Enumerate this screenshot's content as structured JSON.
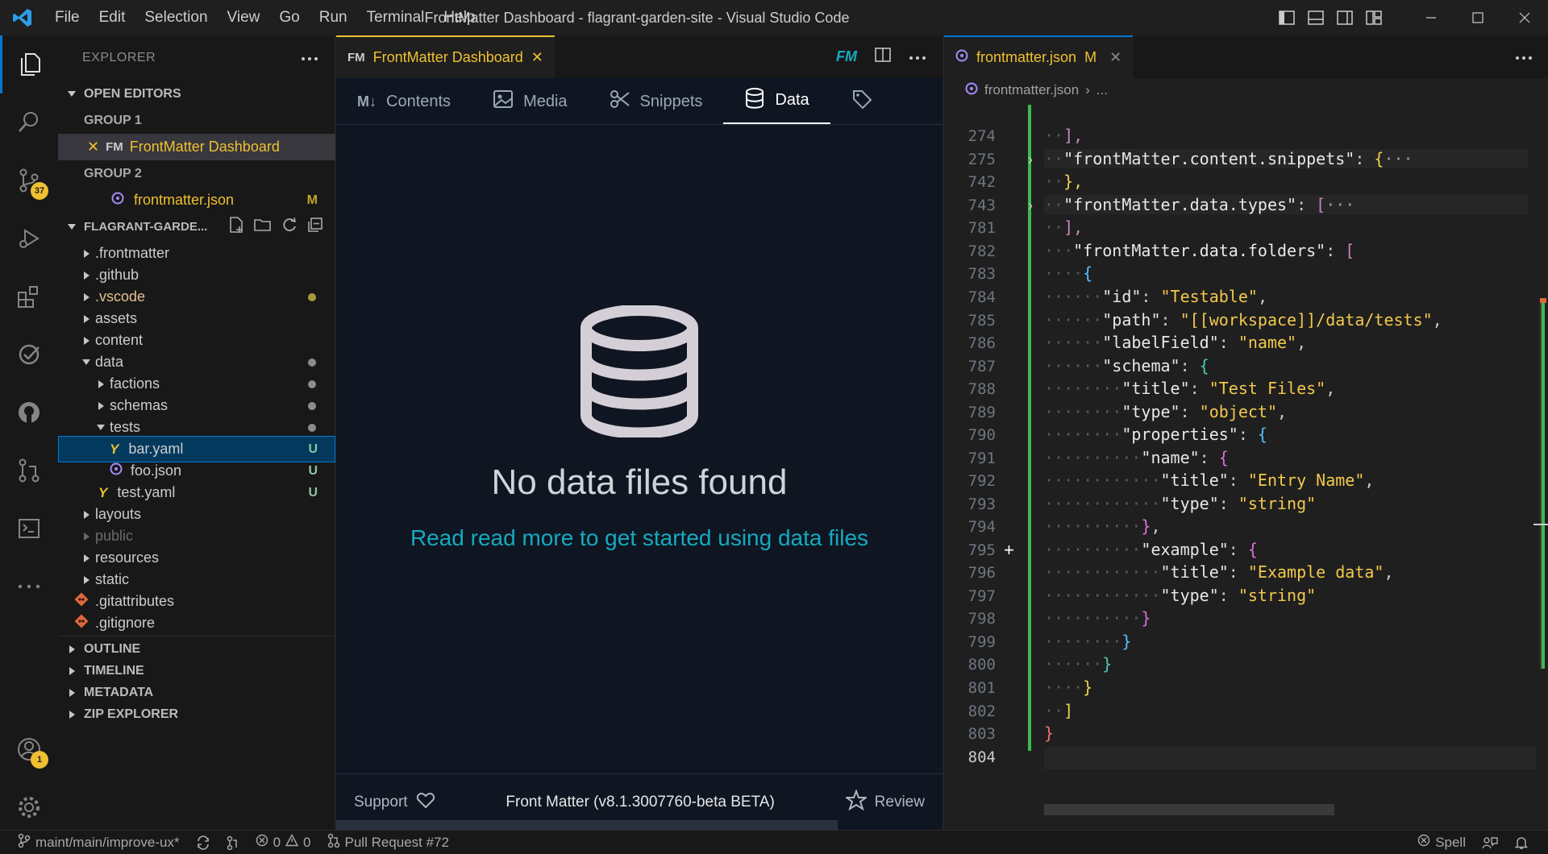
{
  "window": {
    "title": "FrontMatter Dashboard - flagrant-garden-site - Visual Studio Code"
  },
  "menu": [
    "File",
    "Edit",
    "Selection",
    "View",
    "Go",
    "Run",
    "Terminal",
    "Help"
  ],
  "activity": {
    "scm_badge": "37",
    "accounts_badge": "1"
  },
  "explorer": {
    "title": "EXPLORER",
    "open_editors": "OPEN EDITORS",
    "group1": "GROUP 1",
    "group1_file": "FrontMatter Dashboard",
    "group2": "GROUP 2",
    "group2_file": "frontmatter.json",
    "group2_deco": "M",
    "project": "FLAGRANT-GARDE...",
    "tree": [
      {
        "name": ".frontmatter"
      },
      {
        "name": ".github"
      },
      {
        "name": ".vscode"
      },
      {
        "name": "assets"
      },
      {
        "name": "content"
      },
      {
        "name": "data"
      },
      {
        "name": "factions"
      },
      {
        "name": "schemas"
      },
      {
        "name": "tests"
      },
      {
        "name": "bar.yaml",
        "deco": "U"
      },
      {
        "name": "foo.json",
        "deco": "U"
      },
      {
        "name": "test.yaml",
        "deco": "U"
      },
      {
        "name": "layouts"
      },
      {
        "name": "public"
      },
      {
        "name": "resources"
      },
      {
        "name": "static"
      },
      {
        "name": ".gitattributes"
      },
      {
        "name": ".gitignore"
      }
    ],
    "outline": "OUTLINE",
    "timeline": "TIMELINE",
    "metadata": "METADATA",
    "zip": "ZIP EXPLORER"
  },
  "left_editor": {
    "tab_label": "FrontMatter Dashboard",
    "nav": [
      "Contents",
      "Media",
      "Snippets",
      "Data"
    ],
    "empty_title": "No data files found",
    "empty_link": "Read read more to get started using data files",
    "footer_support": "Support",
    "footer_version": "Front Matter (v8.1.3007760-beta BETA)",
    "footer_review": "Review"
  },
  "right_editor": {
    "tab_label": "frontmatter.json",
    "tab_deco": "M",
    "breadcrumb_file": "frontmatter.json",
    "breadcrumb_more": "...",
    "line_numbers": [
      "274",
      "275",
      "742",
      "743",
      "781",
      "782",
      "783",
      "784",
      "785",
      "786",
      "787",
      "788",
      "789",
      "790",
      "791",
      "792",
      "793",
      "794",
      "795",
      "796",
      "797",
      "798",
      "799",
      "800",
      "801",
      "802",
      "803",
      "804"
    ],
    "code": {
      "l274": "],",
      "l275k": "\"frontMatter.content.snippets\"",
      "l742": "},",
      "l743k": "\"frontMatter.data.types\"",
      "l781": "],",
      "l782k": "\"frontMatter.data.folders\"",
      "k_id": "\"id\"",
      "v_id": "\"Testable\"",
      "k_path": "\"path\"",
      "v_path": "\"[[workspace]]/data/tests\"",
      "k_labelField": "\"labelField\"",
      "v_labelField": "\"name\"",
      "k_schema": "\"schema\"",
      "k_title": "\"title\"",
      "v_title": "\"Test Files\"",
      "k_type": "\"type\"",
      "v_type": "\"object\"",
      "k_properties": "\"properties\"",
      "k_name": "\"name\"",
      "v_name_title": "\"Entry Name\"",
      "v_string": "\"string\"",
      "k_example": "\"example\"",
      "v_example_title": "\"Example data\""
    }
  },
  "statusbar": {
    "branch": "maint/main/improve-ux*",
    "errors": "0",
    "warnings": "0",
    "pr": "Pull Request #72",
    "spell": "Spell"
  }
}
